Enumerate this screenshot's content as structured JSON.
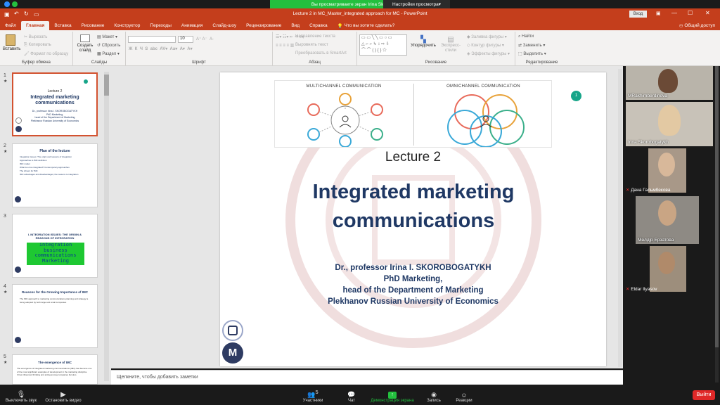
{
  "zoom_top": {
    "sharing_banner": "Вы просматриваете экран Irina Skorobogatykh",
    "view_options": "Настройки просмотра"
  },
  "ppt": {
    "window_title": "Lecture 2  in MC_Master_integrated approach for MC  -  PowerPoint",
    "login_button": "Вход",
    "tabs": [
      "Файл",
      "Главная",
      "Вставка",
      "Рисование",
      "Конструктор",
      "Переходы",
      "Анимация",
      "Слайд-шоу",
      "Рецензирование",
      "Вид",
      "Справка"
    ],
    "tell_me": "Что вы хотите сделать?",
    "share": "Общий доступ",
    "ribbon": {
      "clipboard": {
        "paste": "Вставить",
        "cut": "Вырезать",
        "copy": "Копировать",
        "format_painter": "Формат по образцу",
        "label": "Буфер обмена"
      },
      "slides": {
        "new_slide": "Создать слайд",
        "layout": "Макет",
        "reset": "Сбросить",
        "section": "Раздел",
        "label": "Слайды"
      },
      "font": {
        "font_name": "",
        "font_size": "10",
        "label": "Шрифт"
      },
      "paragraph": {
        "text_direction": "Направление текста",
        "align_text": "Выровнять текст",
        "smartart": "Преобразовать в SmartArt",
        "label": "Абзац"
      },
      "drawing": {
        "arrange": "Упорядочить",
        "quick_styles": "Экспресс-стили",
        "fill": "Заливка фигуры",
        "outline": "Контур фигуры",
        "effects": "Эффекты фигуры",
        "label": "Рисование"
      },
      "editing": {
        "find": "Найти",
        "replace": "Заменить",
        "select": "Выделить",
        "label": "Редактирование"
      }
    },
    "notes_placeholder": "Щелкните, чтобы добавить заметки"
  },
  "thumbnails": [
    {
      "num": "1",
      "star": "★",
      "title": "Lecture 2",
      "subtitle": "Integrated marketing communications",
      "lines": [
        "Dr., professor Irina I. SKOROBOGATYKH",
        "PhD Marketing,",
        "head of the Department of Marketing",
        "Plekhanov Russian University of Economics"
      ]
    },
    {
      "num": "2",
      "star": "★",
      "title": "Plan of the lecture",
      "lines": [
        "Integration issues: The origin and reasons of integration",
        "Approaches to IMC definition",
        "IMC model",
        "What is a true integrated? Contemporary approaches",
        "The drivers for IMC",
        "IMC advantages and disadvantages; the reasons to integration"
      ]
    },
    {
      "num": "3",
      "star": "",
      "title": "I. INTEGRATION ISSUES: THE ORIGIN & REASONS OF INTEGRATION",
      "lines": [
        "integration",
        "business",
        "communications",
        "Marketing"
      ]
    },
    {
      "num": "4",
      "star": "★",
      "title": "Reasons for the Growing Importance of IMC",
      "lines": [
        "The IMC approach to marketing communications planning and strategy is being adopted by both large and small companies"
      ]
    },
    {
      "num": "5",
      "star": "★",
      "title": "The emergence of IMC",
      "lines": [
        "The emergence of integrated marketing communications (IMC) has become one of the most significant examples of development in the marketing discipline",
        "It has influenced thinking and acting among companies but also"
      ]
    }
  ],
  "slide": {
    "diagram_left_title": "MULTICHANNEL COMMUNICATION",
    "diagram_right_title": "OMNICHANNEL COMMUNICATION",
    "lecture_label": "Lecture 2",
    "title": "Integrated marketing communications",
    "author_lines": [
      "Dr., professor Irina I. SKOROBOGATYKH",
      "PhD Marketing,",
      "head of the Department of Marketing",
      "Plekhanov Russian University of Economics"
    ],
    "badge": "1"
  },
  "participants": [
    {
      "name": "MRakhimberdinova",
      "muted": false
    },
    {
      "name": "Irina Skorobogatykh",
      "muted": false
    },
    {
      "name": "Дана Гальмбекова",
      "muted": true
    },
    {
      "name": "Мөлдір Ерзатова",
      "muted": false
    },
    {
      "name": "Eldar Ilyasov",
      "muted": true
    }
  ],
  "zoom_bar": {
    "mute": "Выключить звук",
    "video": "Остановить видео",
    "participants": "Участники",
    "participants_count": "5",
    "chat": "Чат",
    "share": "Демонстрация экрана",
    "record": "Запись",
    "reactions": "Реакции",
    "leave": "Выйти"
  },
  "colors": {
    "ppt_accent": "#c43e1c",
    "zoom_green": "#23c03e",
    "slide_navy": "#1f3864",
    "leave_red": "#e02828"
  }
}
